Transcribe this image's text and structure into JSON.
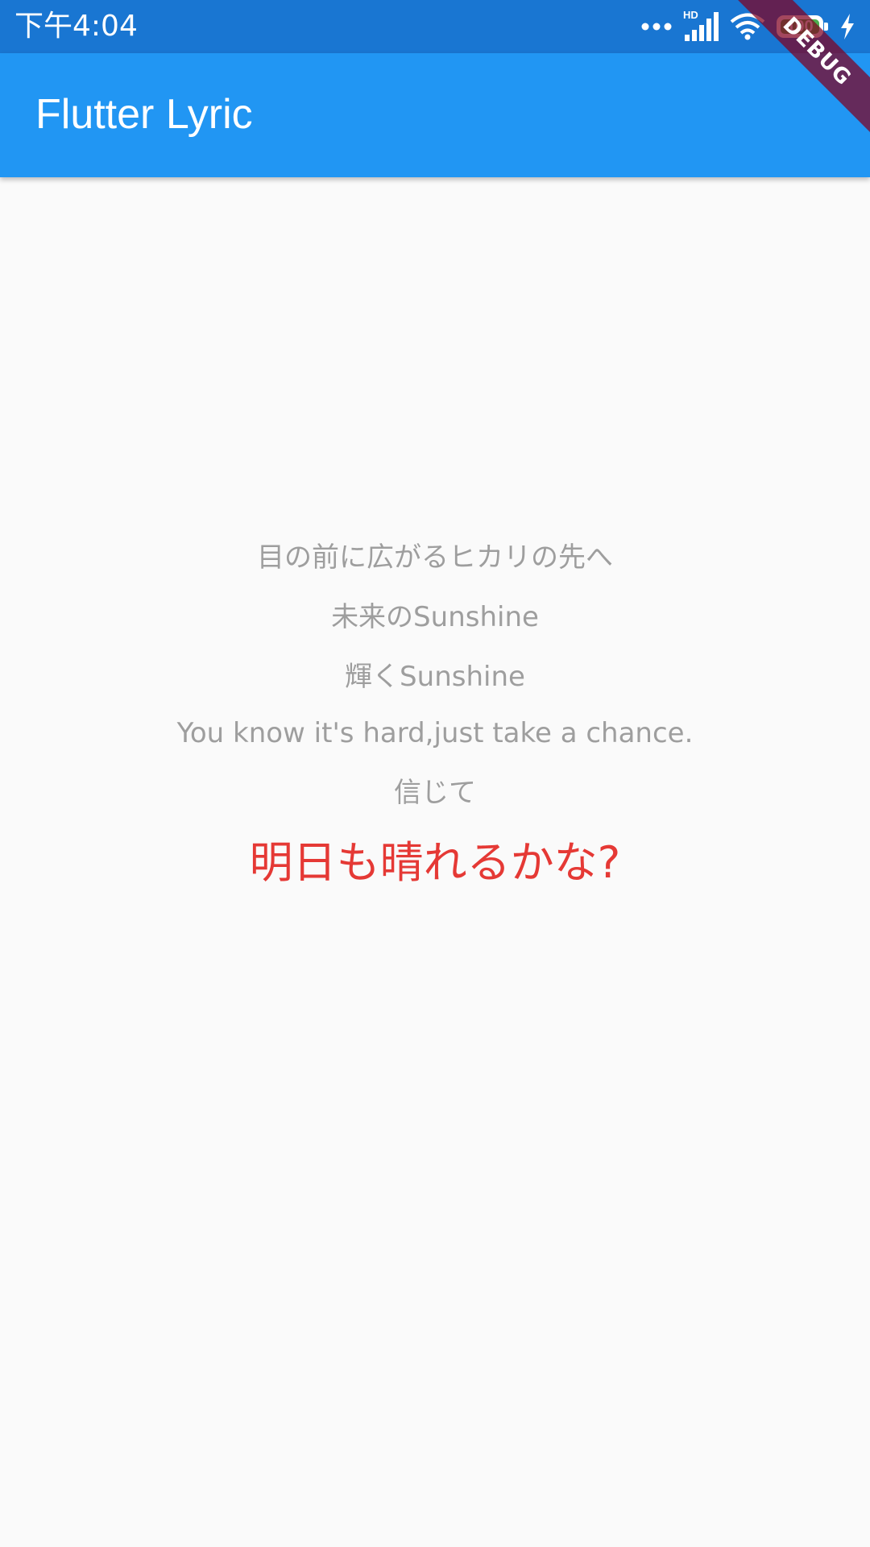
{
  "status_bar": {
    "time": "下午4:04",
    "network_badge": "HD",
    "battery_level": "100",
    "battery_fill_fraction": 1.0,
    "icons": [
      "dots-icon",
      "signal-icon",
      "wifi-icon",
      "battery-icon",
      "charging-icon"
    ]
  },
  "app_bar": {
    "title": "Flutter Lyric"
  },
  "debug_banner": {
    "label": "DEBUG"
  },
  "lyrics": {
    "lines": [
      "目の前に広がるヒカリの先へ",
      "未来のSunshine",
      "輝くSunshine",
      "You know it's hard,just take a chance.",
      "信じて"
    ],
    "current_line": "明日も晴れるかな?"
  },
  "colors": {
    "status_bar": "#1976d2",
    "app_bar": "#2196f3",
    "background": "#fafafa",
    "lyric_text": "#9e9e9e",
    "current_lyric": "#e53935"
  }
}
